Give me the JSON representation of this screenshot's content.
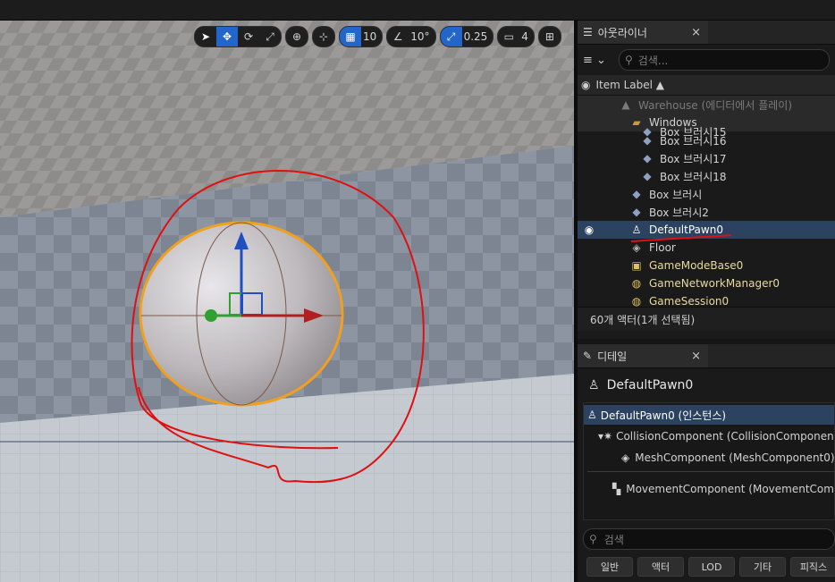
{
  "viewport": {
    "toolbar": {
      "grid_snap": "10",
      "rotation_snap": "10°",
      "scale_snap": "0.25",
      "camera_speed": "4"
    }
  },
  "outliner": {
    "tab_title": "아웃라이너",
    "close": "×",
    "search_placeholder": "검색...",
    "column_label": "Item Label ▲",
    "items": [
      {
        "label": "Warehouse (에디터에서 플레이)",
        "icon": "level-icon"
      },
      {
        "label": "Windows",
        "icon": "folder-icon"
      },
      {
        "label": "Box 브러시15",
        "icon": "brush-icon"
      },
      {
        "label": "Box 브러시16",
        "icon": "brush-icon"
      },
      {
        "label": "Box 브러시17",
        "icon": "brush-icon"
      },
      {
        "label": "Box 브러시18",
        "icon": "brush-icon"
      },
      {
        "label": "Box 브러시",
        "icon": "brush-icon"
      },
      {
        "label": "Box 브러시2",
        "icon": "brush-icon"
      },
      {
        "label": "DefaultPawn0",
        "icon": "pawn-icon"
      },
      {
        "label": "Floor",
        "icon": "static-mesh-icon"
      },
      {
        "label": "GameModeBase0",
        "icon": "game-mode-icon"
      },
      {
        "label": "GameNetworkManager0",
        "icon": "network-icon"
      },
      {
        "label": "GameSession0",
        "icon": "session-icon"
      }
    ],
    "actor_count": "60개 액터(1개 선택됨)"
  },
  "details": {
    "tab_title": "디테일",
    "close": "×",
    "actor_name": "DefaultPawn0",
    "components": [
      {
        "label": "DefaultPawn0 (인스턴스)"
      },
      {
        "label": "CollisionComponent (CollisionComponent)"
      },
      {
        "label": "MeshComponent (MeshComponent0)"
      },
      {
        "label": "MovementComponent (MovementComponent0)"
      }
    ],
    "search_placeholder": "검색",
    "categories": [
      "일반",
      "액터",
      "LOD",
      "기타",
      "피직스"
    ]
  },
  "colors": {
    "selection": "#2c4261",
    "accent": "#2266cc",
    "annotation": "#e01010",
    "highlight_outline": "#f0a020"
  }
}
